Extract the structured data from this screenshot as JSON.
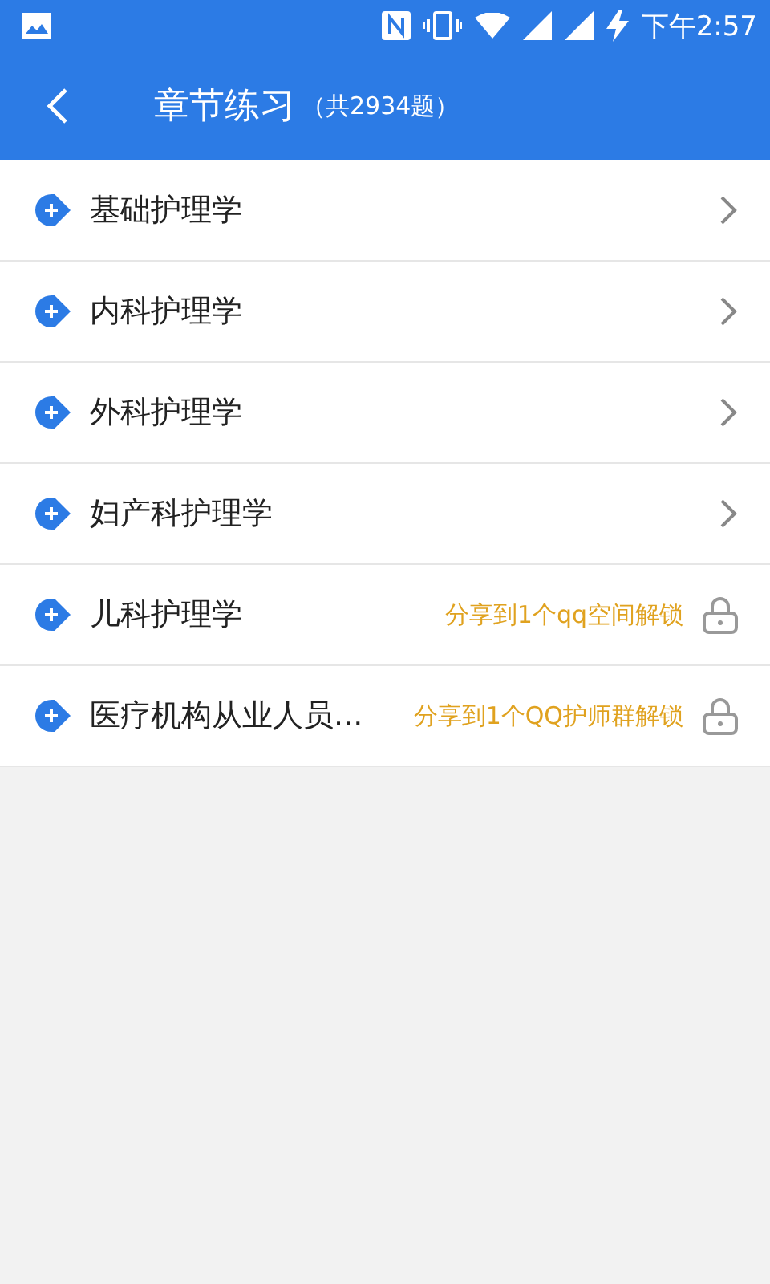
{
  "status_bar": {
    "time": "下午2:57"
  },
  "header": {
    "title": "章节练习",
    "count": "（共2934题）"
  },
  "chapters": [
    {
      "kind": "open",
      "name": "基础护理学"
    },
    {
      "kind": "open",
      "name": "内科护理学"
    },
    {
      "kind": "open",
      "name": "外科护理学"
    },
    {
      "kind": "open",
      "name": "妇产科护理学"
    },
    {
      "kind": "locked",
      "name": "儿科护理学",
      "hint": "分享到1个qq空间解锁"
    },
    {
      "kind": "locked",
      "name": "医疗机构从业人员...",
      "hint": "分享到1个QQ护师群解锁"
    }
  ]
}
